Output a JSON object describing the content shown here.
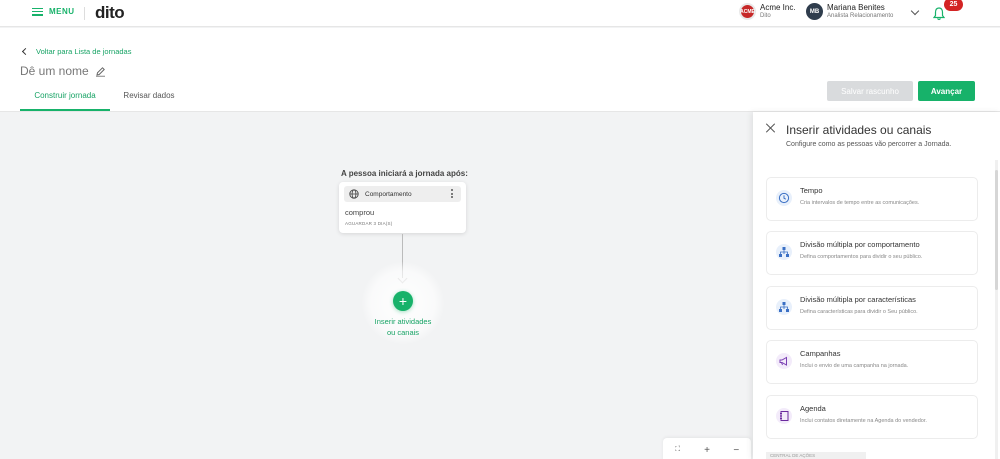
{
  "topbar": {
    "menu_label": "MENU",
    "logo": "dito",
    "org": {
      "badge": "ACME",
      "name": "Acme Inc.",
      "sub": "Dito"
    },
    "user": {
      "initials": "MB",
      "name": "Mariana Benites",
      "role": "Analista Relacionamento"
    },
    "notifications": "25"
  },
  "header": {
    "back_label": "Voltar para Lista de jornadas",
    "title": "Dê um nome",
    "tabs": [
      {
        "label": "Construir jornada"
      },
      {
        "label": "Revisar dados"
      }
    ],
    "save_draft_label": "Salvar rascunho",
    "next_label": "Avançar"
  },
  "canvas": {
    "start_label": "A pessoa iniciará a jornada após:",
    "node": {
      "type_label": "Comportamento",
      "value": "comprou",
      "wait": "AGUARDAR 3 DIA(S)"
    },
    "add_label_1": "Inserir atividades",
    "add_label_2": "ou canais",
    "add_symbol": "+",
    "zoom": {
      "fit": "⛶",
      "in": "+",
      "out": "−"
    }
  },
  "panel": {
    "title": "Inserir atividades ou canais",
    "subtitle": "Configure como as pessoas vão percorrer a Jornada.",
    "items": [
      {
        "title": "Tempo",
        "desc": "Cria intervalos de tempo entre as comunicações.",
        "icon": "clock-icon"
      },
      {
        "title": "Divisão múltipla por comportamento",
        "desc": "Defina comportamentos para dividir o seu público.",
        "icon": "split-icon"
      },
      {
        "title": "Divisão múltipla por características",
        "desc": "Defina características para dividir o Seu público.",
        "icon": "split-icon"
      },
      {
        "title": "Campanhas",
        "desc": "Inclui o envio de uma campanha na jornada.",
        "icon": "megaphone-icon"
      },
      {
        "title": "Agenda",
        "desc": "Inclui contatos diretamente na Agenda do vendedor.",
        "icon": "agenda-icon"
      }
    ],
    "next_section": "CENTRAL DE AÇÕES"
  },
  "colors": {
    "accent": "#17b26a",
    "badge": "#d32424",
    "disabled": "#d9dbdd"
  }
}
